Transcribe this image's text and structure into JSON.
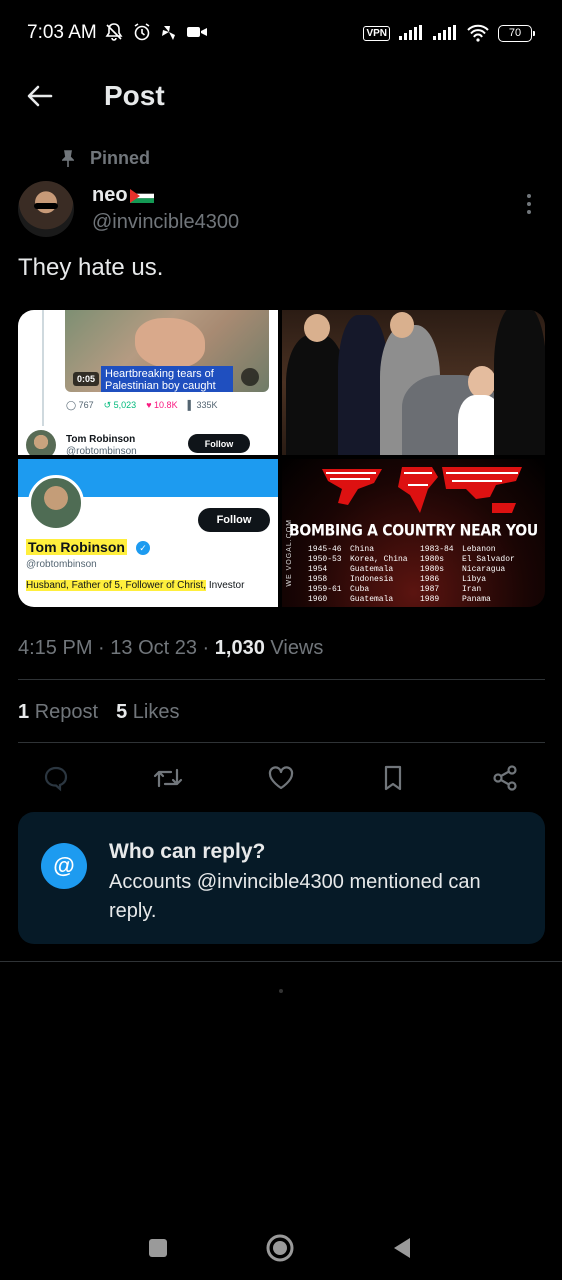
{
  "status_bar": {
    "time": "7:03 AM",
    "vpn": "VPN",
    "battery": "70"
  },
  "header": {
    "title": "Post",
    "back_icon": "arrow-left-icon"
  },
  "pinned": {
    "label": "Pinned",
    "icon": "pin-icon"
  },
  "author": {
    "name": "neo",
    "flag": "palestine-flag-icon",
    "handle": "@invincible4300"
  },
  "tweet": {
    "text": "They hate us."
  },
  "media": {
    "tile1": {
      "duration": "0:05",
      "caption": "Heartbreaking tears of Palestinian boy caught",
      "replies": "767",
      "reposts": "5,023",
      "likes": "10.8K",
      "views": "335K",
      "name": "Tom Robinson",
      "handle": "@robtombinson",
      "follow": "Follow"
    },
    "tile3": {
      "follow": "Follow",
      "name": "Tom Robinson",
      "handle": "@robtombinson",
      "bio_highlight": "Husband, Father of 5, Follower of Christ,",
      "bio_rest": " Investor"
    },
    "tile4": {
      "title": "BOMBING A COUNTRY NEAR YOU",
      "side_text": "WE VOGAL.COM",
      "list": [
        [
          "1945-46",
          "China",
          "1983-84",
          "Lebanon"
        ],
        [
          "1950-53",
          "Korea, China",
          "1980s",
          "El Salvador"
        ],
        [
          "1954",
          "Guatemala",
          "1980s",
          "Nicaragua"
        ],
        [
          "1958",
          "Indonesia",
          "1986",
          "Libya"
        ],
        [
          "1959-61",
          "Cuba",
          "1987",
          "Iran"
        ],
        [
          "1960",
          "Guatemala",
          "1989",
          "Panama"
        ]
      ]
    }
  },
  "meta": {
    "time": "4:15 PM",
    "date": "13 Oct 23",
    "views_count": "1,030",
    "views_label": "Views"
  },
  "counts": {
    "reposts_count": "1",
    "reposts_label": "Repost",
    "likes_count": "5",
    "likes_label": "Likes"
  },
  "actions": [
    "reply-icon",
    "repost-icon",
    "like-icon",
    "bookmark-icon",
    "share-icon"
  ],
  "reply_card": {
    "icon": "@",
    "title": "Who can reply?",
    "body": "Accounts @invincible4300 mentioned can reply."
  },
  "colors": {
    "accent": "#1d9bf0",
    "muted": "#71767b",
    "card_bg": "#061a27"
  }
}
